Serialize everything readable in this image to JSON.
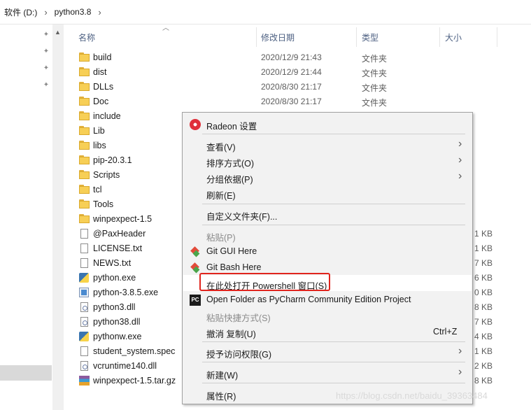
{
  "breadcrumb": {
    "drive": "软件 (D:)",
    "folder": "python3.8"
  },
  "columns": {
    "name": "名称",
    "modified": "修改日期",
    "type": "类型",
    "size": "大小"
  },
  "files": [
    {
      "name": "build",
      "date": "2020/12/9 21:43",
      "type": "文件夹",
      "size": "",
      "icon": "folder"
    },
    {
      "name": "dist",
      "date": "2020/12/9 21:44",
      "type": "文件夹",
      "size": "",
      "icon": "folder"
    },
    {
      "name": "DLLs",
      "date": "2020/8/30 21:17",
      "type": "文件夹",
      "size": "",
      "icon": "folder"
    },
    {
      "name": "Doc",
      "date": "2020/8/30 21:17",
      "type": "文件夹",
      "size": "",
      "icon": "folder"
    },
    {
      "name": "include",
      "date": "",
      "type": "",
      "size": "",
      "icon": "folder"
    },
    {
      "name": "Lib",
      "date": "",
      "type": "",
      "size": "",
      "icon": "folder"
    },
    {
      "name": "libs",
      "date": "",
      "type": "",
      "size": "",
      "icon": "folder"
    },
    {
      "name": "pip-20.3.1",
      "date": "",
      "type": "",
      "size": "",
      "icon": "folder"
    },
    {
      "name": "Scripts",
      "date": "",
      "type": "",
      "size": "",
      "icon": "folder"
    },
    {
      "name": "tcl",
      "date": "",
      "type": "",
      "size": "",
      "icon": "folder"
    },
    {
      "name": "Tools",
      "date": "",
      "type": "",
      "size": "",
      "icon": "folder"
    },
    {
      "name": "winpexpect-1.5",
      "date": "",
      "type": "",
      "size": "",
      "icon": "folder"
    },
    {
      "name": "@PaxHeader",
      "date": "",
      "type": "",
      "size": "1 KB",
      "icon": "file"
    },
    {
      "name": "LICENSE.txt",
      "date": "",
      "type": "",
      "size": "1 KB",
      "icon": "file"
    },
    {
      "name": "NEWS.txt",
      "date": "",
      "type": "",
      "size": "7 KB",
      "icon": "file"
    },
    {
      "name": "python.exe",
      "date": "",
      "type": "",
      "size": "6 KB",
      "icon": "exe"
    },
    {
      "name": "python-3.8.5.exe",
      "date": "",
      "type": "",
      "size": "0 KB",
      "icon": "installer"
    },
    {
      "name": "python3.dll",
      "date": "",
      "type": "",
      "size": "8 KB",
      "icon": "dll"
    },
    {
      "name": "python38.dll",
      "date": "",
      "type": "",
      "size": "7 KB",
      "icon": "dll"
    },
    {
      "name": "pythonw.exe",
      "date": "",
      "type": "",
      "size": "4 KB",
      "icon": "exe"
    },
    {
      "name": "student_system.spec",
      "date": "",
      "type": "",
      "size": "1 KB",
      "icon": "file"
    },
    {
      "name": "vcruntime140.dll",
      "date": "",
      "type": "",
      "size": "2 KB",
      "icon": "dll"
    },
    {
      "name": "winpexpect-1.5.tar.gz",
      "date": "",
      "type": "",
      "size": "8 KB",
      "icon": "archive"
    }
  ],
  "context_menu": {
    "radeon": "Radeon 设置",
    "view": "查看(V)",
    "sort": "排序方式(O)",
    "group": "分组依据(P)",
    "refresh": "刷新(E)",
    "customize": "自定义文件夹(F)...",
    "paste": "粘贴(P)",
    "git_gui": "Git GUI Here",
    "git_bash": "Git Bash Here",
    "powershell": "在此处打开 Powershell 窗口(S)",
    "pycharm": "Open Folder as PyCharm Community Edition Project",
    "paste_shortcut": "粘贴快捷方式(S)",
    "undo": "撤消 复制(U)",
    "undo_shortcut": "Ctrl+Z",
    "access": "授予访问权限(G)",
    "new": "新建(W)",
    "properties": "属性(R)"
  },
  "watermark": "https://blog.csdn.net/baidu_39363484",
  "colors": {
    "highlight_box": "#e0241d",
    "menu_bg": "#f2f2f2",
    "folder": "#f7cf56"
  }
}
